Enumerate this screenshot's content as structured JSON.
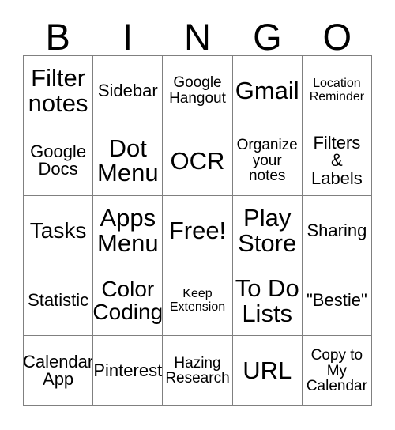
{
  "card": {
    "header_letters": [
      "B",
      "I",
      "N",
      "G",
      "O"
    ],
    "rows": [
      [
        {
          "text": "Filter\nnotes",
          "size": "xl"
        },
        {
          "text": "Sidebar",
          "size": "md"
        },
        {
          "text": "Google\nHangout",
          "size": "sm"
        },
        {
          "text": "Gmail",
          "size": "xl"
        },
        {
          "text": "Location\nReminder",
          "size": "xs"
        }
      ],
      [
        {
          "text": "Google\nDocs",
          "size": "md"
        },
        {
          "text": "Dot\nMenu",
          "size": "xl"
        },
        {
          "text": "OCR",
          "size": "xl"
        },
        {
          "text": "Organize\nyour\nnotes",
          "size": "sm"
        },
        {
          "text": "Filters\n&\nLabels",
          "size": "md"
        }
      ],
      [
        {
          "text": "Tasks",
          "size": "lg"
        },
        {
          "text": "Apps\nMenu",
          "size": "xl"
        },
        {
          "text": "Free!",
          "size": "xl"
        },
        {
          "text": "Play\nStore",
          "size": "xl"
        },
        {
          "text": "Sharing",
          "size": "md"
        }
      ],
      [
        {
          "text": "Statistic",
          "size": "md"
        },
        {
          "text": "Color\nCoding",
          "size": "lg"
        },
        {
          "text": "Keep\nExtension",
          "size": "xs"
        },
        {
          "text": "To Do\nLists",
          "size": "xl"
        },
        {
          "text": "\"Bestie\"",
          "size": "md"
        }
      ],
      [
        {
          "text": "Calendar\nApp",
          "size": "md"
        },
        {
          "text": "Pinterest",
          "size": "md"
        },
        {
          "text": "Hazing\nResearch",
          "size": "sm"
        },
        {
          "text": "URL",
          "size": "xl"
        },
        {
          "text": "Copy to\nMy\nCalendar",
          "size": "sm"
        }
      ]
    ]
  },
  "colors": {
    "text": "#000000",
    "grid_line": "#808080",
    "background": "#ffffff"
  }
}
